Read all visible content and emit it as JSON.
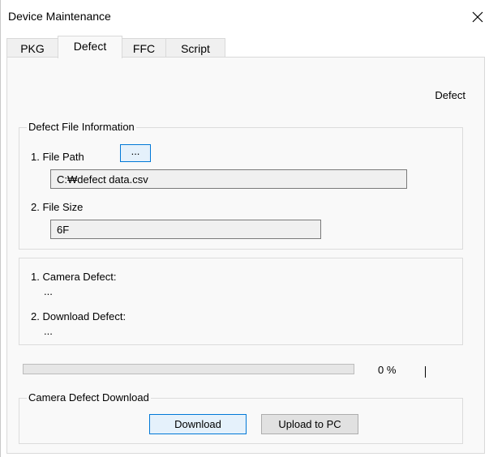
{
  "window": {
    "title": "Device Maintenance",
    "close_icon": "close-icon"
  },
  "tabs": [
    {
      "label": "PKG",
      "active": false
    },
    {
      "label": "Defect",
      "active": true
    },
    {
      "label": "FFC",
      "active": false
    },
    {
      "label": "Script",
      "active": false
    }
  ],
  "page_heading": "Defect",
  "file_info": {
    "group_title": "Defect File Information",
    "path_label": "1. File Path",
    "browse_label": "...",
    "path_value": "C:₩defect data.csv",
    "size_label": "2. File Size",
    "size_value": "6F"
  },
  "defect_results": {
    "camera_label": "1. Camera Defect:",
    "camera_value": "...",
    "download_label": "2. Download Defect:",
    "download_value": "..."
  },
  "progress": {
    "value_percent": 0,
    "text": "0 %"
  },
  "download_group": {
    "group_title": "Camera Defect Download",
    "download_label": "Download",
    "upload_label": "Upload to PC"
  },
  "colors": {
    "accent": "#0078d7",
    "button_face": "#e1e1e1",
    "panel_bg": "#f9f9f9"
  }
}
